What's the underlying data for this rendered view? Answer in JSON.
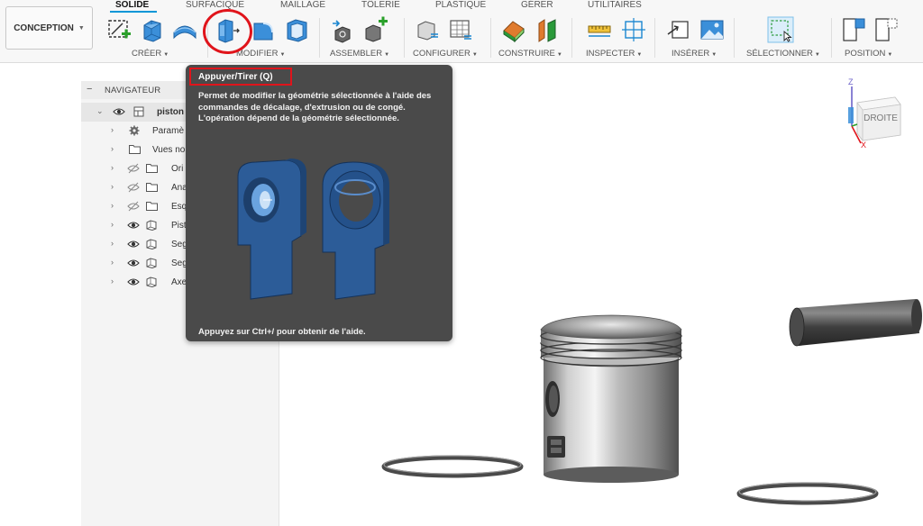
{
  "workspace": {
    "label": "CONCEPTION"
  },
  "tabs": [
    {
      "label": "SOLIDE",
      "active": true
    },
    {
      "label": "SURFACIQUE"
    },
    {
      "label": "MAILLAGE"
    },
    {
      "label": "TÔLERIE"
    },
    {
      "label": "PLASTIQUE"
    },
    {
      "label": "GÉRER"
    },
    {
      "label": "UTILITAIRES"
    }
  ],
  "groups": [
    {
      "label": "CRÉER"
    },
    {
      "label": "MODIFIER"
    },
    {
      "label": "ASSEMBLER"
    },
    {
      "label": "CONFIGURER"
    },
    {
      "label": "CONSTRUIRE"
    },
    {
      "label": "INSPECTER"
    },
    {
      "label": "INSÉRER"
    },
    {
      "label": "SÉLECTIONNER"
    },
    {
      "label": "POSITION"
    }
  ],
  "navigator": {
    "title": "NAVIGATEUR",
    "items": [
      {
        "label": "piston",
        "icon": "component-icon",
        "eye": "visible"
      },
      {
        "label": "Paramè",
        "icon": "gear-icon"
      },
      {
        "label": "Vues no",
        "icon": "folder-icon"
      },
      {
        "label": "Ori",
        "icon": "folder-icon",
        "eye": "hidden"
      },
      {
        "label": "Ana",
        "icon": "folder-icon",
        "eye": "hidden"
      },
      {
        "label": "Esq",
        "icon": "folder-icon",
        "eye": "hidden"
      },
      {
        "label": "Pist",
        "icon": "body-icon",
        "eye": "visible"
      },
      {
        "label": "Seg",
        "icon": "body-icon",
        "eye": "visible"
      },
      {
        "label": "Seg",
        "icon": "body-icon",
        "eye": "visible"
      },
      {
        "label": "Axe",
        "icon": "body-icon",
        "eye": "visible"
      }
    ]
  },
  "tooltip": {
    "title": "Appuyer/Tirer (Q)",
    "description": "Permet de modifier la géométrie sélectionnée à l'aide des commandes de décalage, d'extrusion ou de congé. L'opération dépend de la géométrie sélectionnée.",
    "footer": "Appuyez sur Ctrl+/ pour obtenir de l'aide."
  },
  "viewcube": {
    "face": "DROITE",
    "axis_z": "Z",
    "axis_x": "X"
  },
  "colors": {
    "accent": "#0696d7",
    "highlight": "#e0141b",
    "tooltip_bg": "#4a4a4a"
  }
}
